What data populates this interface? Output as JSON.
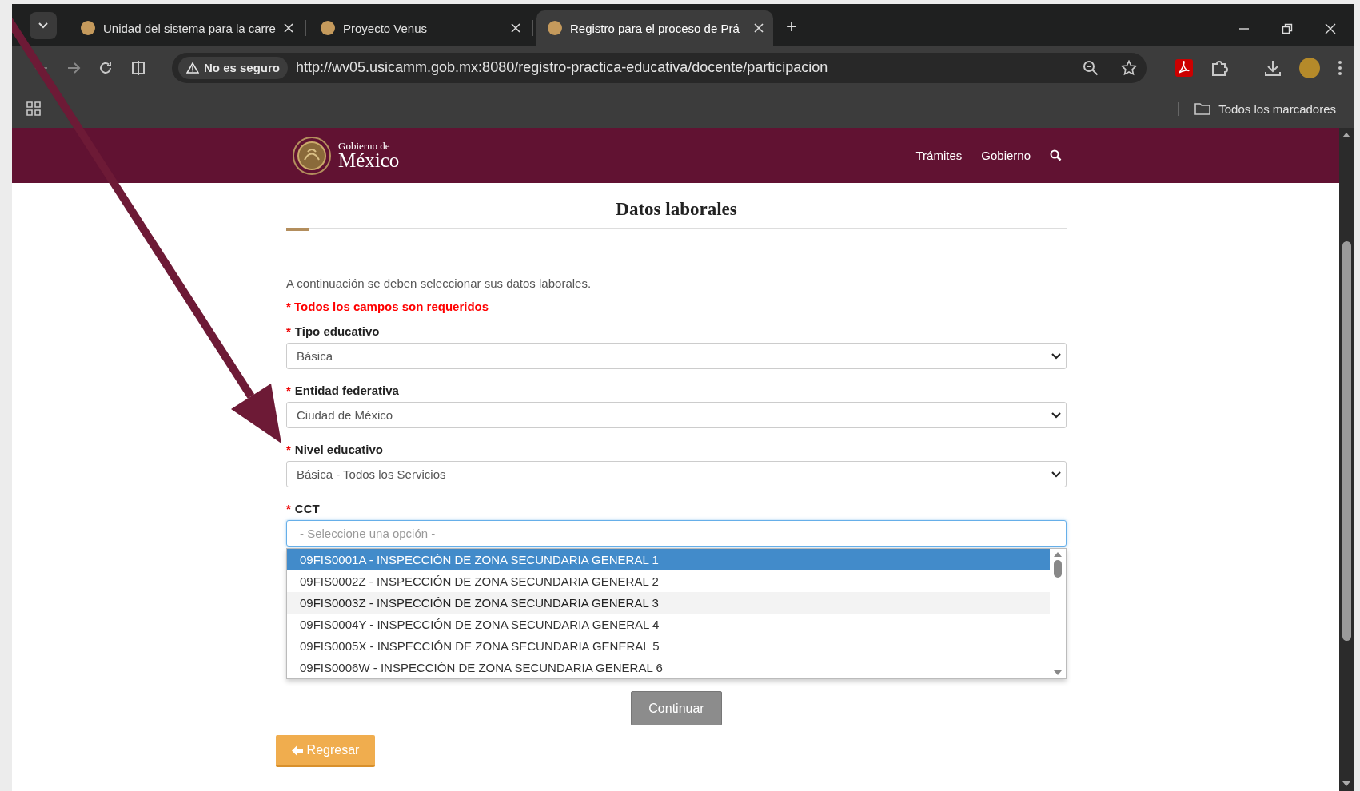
{
  "browser": {
    "tabs": [
      {
        "title": "Unidad del sistema para la carre",
        "selected": false
      },
      {
        "title": "Proyecto Venus",
        "selected": false
      },
      {
        "title": "Registro para el proceso de Prá",
        "selected": true
      }
    ],
    "new_tab": "+",
    "address": {
      "security": "No es seguro",
      "url": "http://wv05.usicamm.gob.mx:8080/registro-practica-educativa/docente/participacion"
    },
    "bookmarks": {
      "label": "Todos los marcadores"
    }
  },
  "header": {
    "brand": {
      "line1": "Gobierno de",
      "line2": "México"
    },
    "nav": [
      "Trámites",
      "Gobierno"
    ]
  },
  "page": {
    "title": "Datos laborales",
    "intro": "A continuación se deben seleccionar sus datos laborales.",
    "required_note": "* Todos los campos son requeridos",
    "fields": [
      {
        "kind": "select",
        "marker": "*",
        "label": "Tipo educativo",
        "value": "Básica"
      },
      {
        "kind": "select",
        "marker": "*",
        "label": "Entidad federativa",
        "value": "Ciudad de México"
      },
      {
        "kind": "select",
        "marker": "*",
        "label": "Nivel educativo",
        "value": "Básica - Todos los Servicios"
      },
      {
        "kind": "combo",
        "marker": "*",
        "label": "CCT",
        "placeholder": "- Seleccione una opción -",
        "options": [
          {
            "text": "09FIS0001A - INSPECCIÓN DE ZONA SECUNDARIA GENERAL 1",
            "selected": true,
            "hovered": false
          },
          {
            "text": "09FIS0002Z - INSPECCIÓN DE ZONA SECUNDARIA GENERAL 2",
            "selected": false,
            "hovered": false
          },
          {
            "text": "09FIS0003Z - INSPECCIÓN DE ZONA SECUNDARIA GENERAL 3",
            "selected": false,
            "hovered": true
          },
          {
            "text": "09FIS0004Y - INSPECCIÓN DE ZONA SECUNDARIA GENERAL 4",
            "selected": false,
            "hovered": false
          },
          {
            "text": "09FIS0005X - INSPECCIÓN DE ZONA SECUNDARIA GENERAL 5",
            "selected": false,
            "hovered": false
          },
          {
            "text": "09FIS0006W - INSPECCIÓN DE ZONA SECUNDARIA GENERAL 6",
            "selected": false,
            "hovered": false
          }
        ]
      }
    ],
    "continue_button": {
      "label": "Continuar"
    },
    "back_button": {
      "label": "Regresar"
    }
  }
}
